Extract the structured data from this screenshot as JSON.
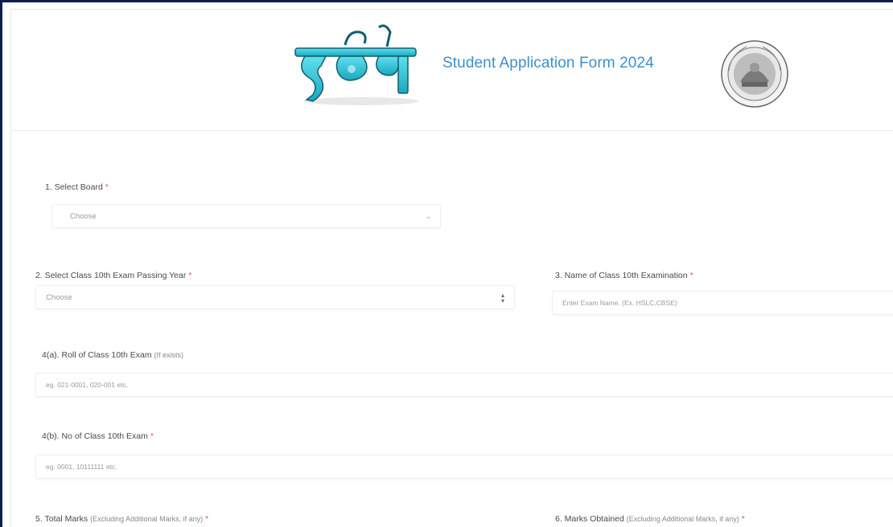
{
  "header": {
    "title": "Student Application Form 2024",
    "logo_icon": "darpan-logo-icon",
    "seal_icon": "institution-seal-icon"
  },
  "form": {
    "q1": {
      "label": "1. Select Board",
      "value": "Choose"
    },
    "q2": {
      "label": "2. Select Class 10th Exam Passing Year",
      "value": "Choose"
    },
    "q3": {
      "label": "3. Name of Class 10th Examination",
      "placeholder": "Enter Exam Name. (Ex. HSLC,CBSE)"
    },
    "q4a": {
      "label": "4(a). Roll of Class 10th Exam",
      "note": "(If exists)",
      "placeholder": "eg. 021-0001, 020-001 etc."
    },
    "q4b": {
      "label": "4(b). No of Class 10th Exam",
      "placeholder": "eg. 0001, 10111111 etc."
    },
    "q5": {
      "label": "5. Total Marks",
      "note": "(Excluding Additional Marks, if any)"
    },
    "q6": {
      "label": "6. Marks Obtained",
      "note": "(Excluding Additional Marks, if any)"
    },
    "required_marker": "*"
  },
  "colors": {
    "title": "#3b8fd1",
    "frame": "#0d1f4f",
    "required": "#e05a5a",
    "logo_main": "#36c3d6"
  }
}
